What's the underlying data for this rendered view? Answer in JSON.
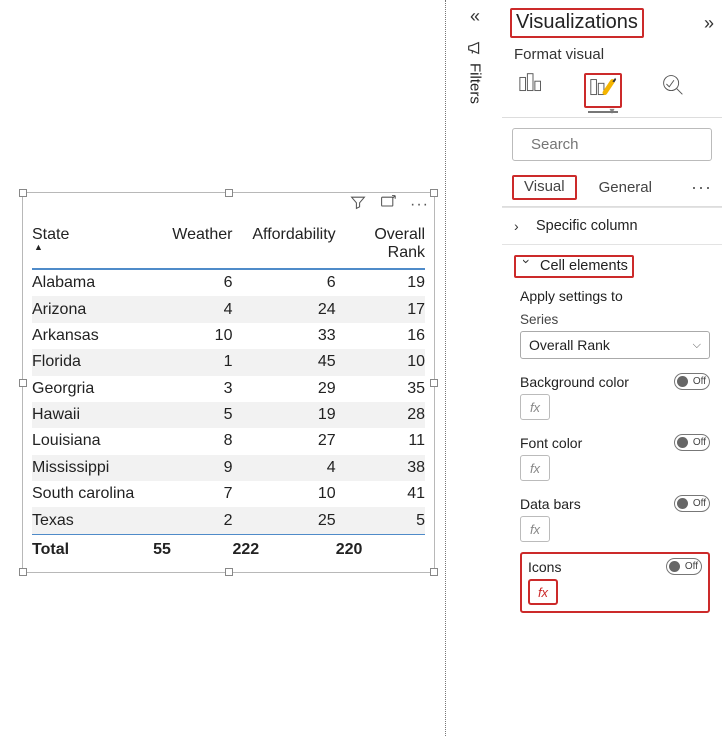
{
  "table": {
    "columns": [
      "State",
      "Weather",
      "Affordability",
      "Overall Rank"
    ],
    "rows": [
      {
        "state": "Alabama",
        "weather": 6,
        "afford": 6,
        "rank": 19
      },
      {
        "state": "Arizona",
        "weather": 4,
        "afford": 24,
        "rank": 17
      },
      {
        "state": "Arkansas",
        "weather": 10,
        "afford": 33,
        "rank": 16
      },
      {
        "state": "Florida",
        "weather": 1,
        "afford": 45,
        "rank": 10
      },
      {
        "state": "Georgria",
        "weather": 3,
        "afford": 29,
        "rank": 35
      },
      {
        "state": "Hawaii",
        "weather": 5,
        "afford": 19,
        "rank": 28
      },
      {
        "state": "Louisiana",
        "weather": 8,
        "afford": 27,
        "rank": 11
      },
      {
        "state": "Mississippi",
        "weather": 9,
        "afford": 4,
        "rank": 38
      },
      {
        "state": "South carolina",
        "weather": 7,
        "afford": 10,
        "rank": 41
      },
      {
        "state": "Texas",
        "weather": 2,
        "afford": 25,
        "rank": 5
      }
    ],
    "total_label": "Total",
    "totals": {
      "weather": 55,
      "afford": 222,
      "rank": 220
    }
  },
  "filters_tab": {
    "label": "Filters"
  },
  "rpane": {
    "title": "Visualizations",
    "subtitle": "Format visual",
    "search_placeholder": "Search",
    "tabs": {
      "visual": "Visual",
      "general": "General"
    },
    "sections": {
      "specific_column": "Specific column",
      "cell_elements": "Cell elements"
    },
    "apply_label": "Apply settings to",
    "series_label": "Series",
    "series_value": "Overall Rank",
    "options": {
      "bg": "Background color",
      "font": "Font color",
      "bars": "Data bars",
      "icons": "Icons",
      "off": "Off",
      "fx": "fx"
    }
  }
}
